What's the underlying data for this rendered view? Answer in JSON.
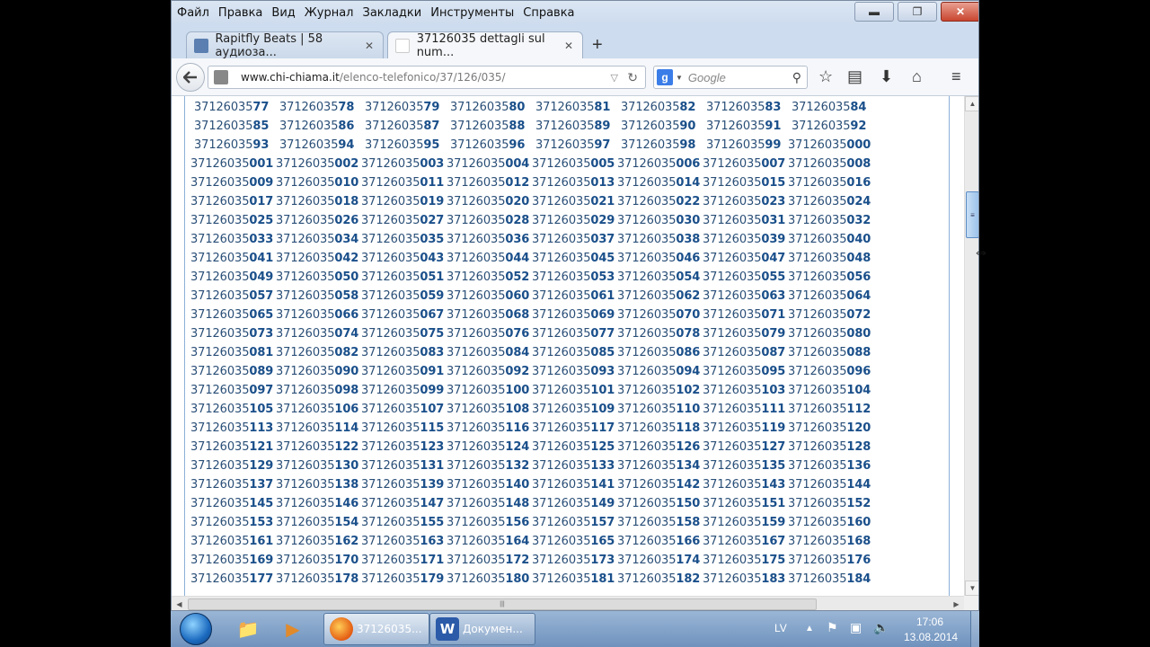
{
  "menubar": {
    "items": [
      "Файл",
      "Правка",
      "Вид",
      "Журнал",
      "Закладки",
      "Инструменты",
      "Справка"
    ]
  },
  "window_controls": {
    "minimize": "▬",
    "maximize": "❐",
    "close": "✕"
  },
  "tabs": [
    {
      "title": "Rapitfly Beats | 58 аудиоза...",
      "close": "✕"
    },
    {
      "title": "37126035 dettagli sul num...",
      "close": "✕"
    }
  ],
  "new_tab": "+",
  "nav": {
    "back": "🡐",
    "url_host": "www.chi-chiama.it",
    "url_path": "/elenco-telefonico/37/126/035/",
    "search_engine": "g",
    "search_placeholder": "Google"
  },
  "icons": {
    "back": "back-arrow-icon",
    "star": "bookmark-star-icon",
    "bookmarks": "bookmarks-list-icon",
    "downloads": "downloads-icon",
    "home": "home-icon",
    "menu": "hamburger-menu-icon"
  },
  "number_prefix": "37126035",
  "number_suffixes_two_digit": [
    "77",
    "78",
    "79",
    "80",
    "81",
    "82",
    "83",
    "84",
    "85",
    "86",
    "87",
    "88",
    "89",
    "90",
    "91",
    "92",
    "93",
    "94",
    "95",
    "96",
    "97",
    "98",
    "99"
  ],
  "number_suffix_three_digit_range": [
    0,
    184
  ],
  "colors": {
    "link": "#2a4f78",
    "highlight": "#1a4f8a",
    "box_border": "#8bb0d6"
  },
  "taskbar": {
    "firefox_task": "37126035...",
    "word_task": "Докумен...",
    "language": "LV",
    "time": "17:06",
    "date": "13.08.2014"
  }
}
